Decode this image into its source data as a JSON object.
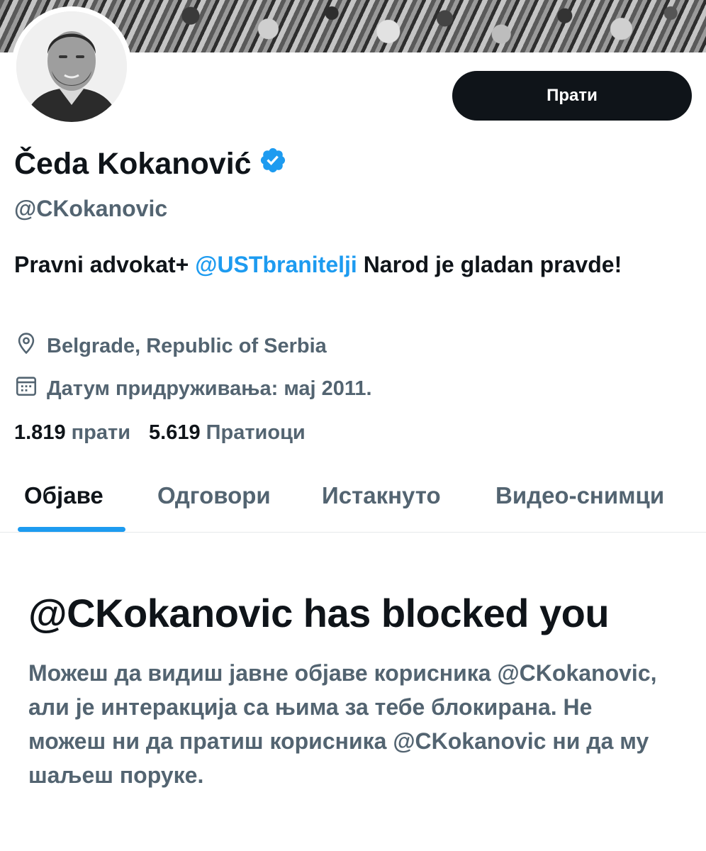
{
  "profile": {
    "display_name": "Čeda Kokanović",
    "handle": "@CKokanovic",
    "follow_label": "Прати",
    "bio": {
      "part1": "Pravni advokat+ ",
      "mention": "@USTbranitelji",
      "part2": " Narod je gladan pravde!"
    },
    "location": "Belgrade, Republic of Serbia",
    "joined": "Датум придруживања: мај 2011.",
    "following_count": "1.819",
    "following_label": "прати",
    "followers_count": "5.619",
    "followers_label": "Пратиоци"
  },
  "tabs": [
    {
      "label": "Објаве"
    },
    {
      "label": "Одговори"
    },
    {
      "label": "Истакнуто"
    },
    {
      "label": "Видео-снимци"
    }
  ],
  "blocked": {
    "title": "@CKokanovic has blocked you",
    "message": "Можеш да видиш јавне објаве корисника @CKokanovic,  али је интеракција са њима за тебе блокирана. Не можеш ни да пратиш корисника @CKokanovic ни да му шаљеш поруке."
  },
  "icons": {
    "verified": "verified-badge-icon",
    "location": "location-pin-icon",
    "calendar": "calendar-icon"
  },
  "colors": {
    "accent": "#1d9bf0",
    "text": "#0f1419",
    "secondary": "#536471",
    "button": "#0f1419"
  }
}
